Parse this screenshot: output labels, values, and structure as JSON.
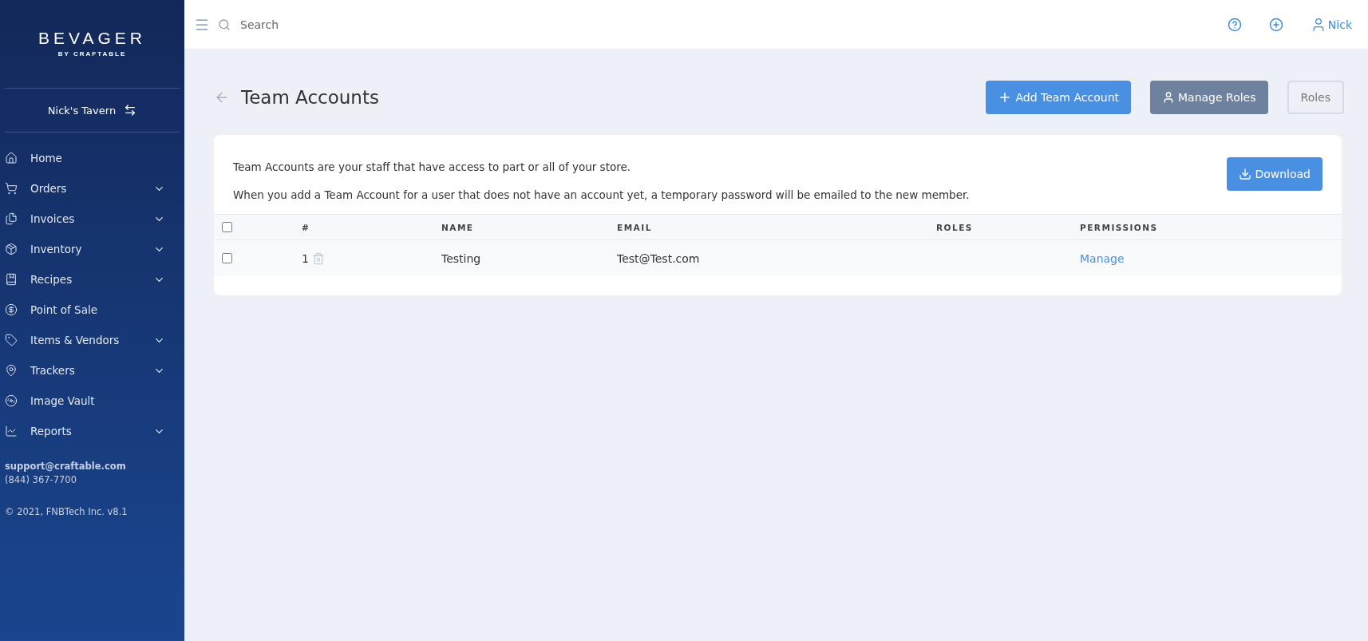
{
  "sidebar": {
    "logo": {
      "title": "BEVAGER",
      "subtitle": "BY CRAFTABLE"
    },
    "store": "Nick's Tavern",
    "items": [
      {
        "label": "Home",
        "expandable": false
      },
      {
        "label": "Orders",
        "expandable": true
      },
      {
        "label": "Invoices",
        "expandable": true
      },
      {
        "label": "Inventory",
        "expandable": true
      },
      {
        "label": "Recipes",
        "expandable": true
      },
      {
        "label": "Point of Sale",
        "expandable": false
      },
      {
        "label": "Items & Vendors",
        "expandable": true
      },
      {
        "label": "Trackers",
        "expandable": true
      },
      {
        "label": "Image Vault",
        "expandable": false
      },
      {
        "label": "Reports",
        "expandable": true
      }
    ],
    "support_email": "support@craftable.com",
    "support_phone": "(844) 367-7700",
    "copyright": "© 2021, FNBTech Inc. v8.1"
  },
  "topbar": {
    "search": {
      "placeholder": "Search"
    },
    "user": "Nick"
  },
  "page": {
    "title": "Team Accounts",
    "buttons": [
      {
        "label": "Add Team Account",
        "kind": "primary"
      },
      {
        "label": "Manage Roles",
        "kind": "secondary"
      },
      {
        "label": "Roles",
        "kind": "outline"
      }
    ]
  },
  "card": {
    "intro": [
      "Team Accounts are your staff that have access to part or all of your store.",
      "When you add a Team Account for a user that does not have an account yet, a temporary password will be emailed to the new member."
    ],
    "download": "Download",
    "table": {
      "select_all": {
        "checked": false
      },
      "columns": [
        "#",
        "NAME",
        "EMAIL",
        "ROLES",
        "PERMISSIONS"
      ],
      "rows": [
        {
          "checked": false,
          "number": "1",
          "name": "Testing",
          "email": "Test@Test.com",
          "permissions": "Manage"
        }
      ]
    }
  }
}
